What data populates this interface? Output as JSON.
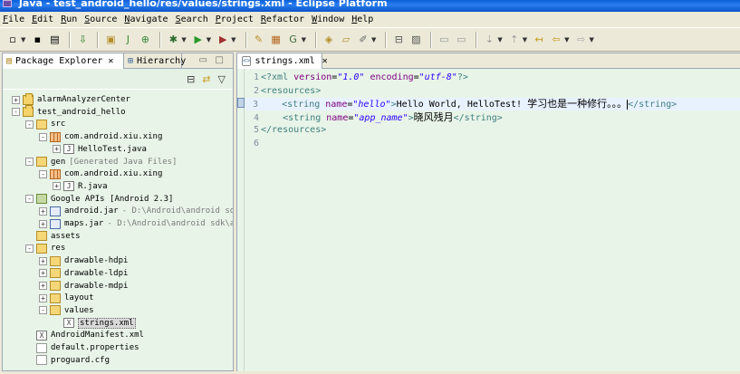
{
  "window": {
    "title": "Java - test_android_hello/res/values/strings.xml - Eclipse Platform"
  },
  "menubar": {
    "items": [
      "File",
      "Edit",
      "Run",
      "Source",
      "Navigate",
      "Search",
      "Project",
      "Refactor",
      "Window",
      "Help"
    ]
  },
  "toolbar": {
    "icons": [
      "new-wizard-icon",
      "save-icon",
      "print-icon",
      "import-icon",
      "new-java-project-icon",
      "new-package-icon",
      "new-class-icon",
      "debug-icon",
      "run-icon",
      "external-tools-icon",
      "open-type-icon",
      "open-task-icon",
      "search-icon",
      "open-perspective-icon",
      "annotation-icon",
      "back-icon",
      "forward-icon"
    ]
  },
  "left_panel": {
    "tabs": [
      {
        "label": "Package Explorer",
        "active": true
      },
      {
        "label": "Hierarchy",
        "active": false
      }
    ],
    "tree": [
      {
        "depth": 0,
        "expander": "+",
        "icon": "project",
        "label": "alarmAnalyzerCenter",
        "extra": ""
      },
      {
        "depth": 0,
        "expander": "-",
        "icon": "project",
        "label": "test_android_hello",
        "extra": ""
      },
      {
        "depth": 1,
        "expander": "-",
        "icon": "src",
        "label": "src",
        "extra": ""
      },
      {
        "depth": 2,
        "expander": "-",
        "icon": "pkg",
        "label": "com.android.xiu.xing",
        "extra": ""
      },
      {
        "depth": 3,
        "expander": "+",
        "icon": "java",
        "label": "HelloTest.java",
        "extra": ""
      },
      {
        "depth": 1,
        "expander": "-",
        "icon": "src",
        "label": "gen",
        "extra": "[Generated Java Files]"
      },
      {
        "depth": 2,
        "expander": "-",
        "icon": "pkg",
        "label": "com.android.xiu.xing",
        "extra": ""
      },
      {
        "depth": 3,
        "expander": "+",
        "icon": "java",
        "label": "R.java",
        "extra": ""
      },
      {
        "depth": 1,
        "expander": "-",
        "icon": "lib",
        "label": "Google APIs [Android 2.3]",
        "extra": ""
      },
      {
        "depth": 2,
        "expander": "+",
        "icon": "jar",
        "label": "android.jar",
        "extra": "- D:\\Android\\android sdk\\p"
      },
      {
        "depth": 2,
        "expander": "+",
        "icon": "jar",
        "label": "maps.jar",
        "extra": "- D:\\Android\\android sdk\\add-"
      },
      {
        "depth": 1,
        "expander": "",
        "icon": "folder",
        "label": "assets",
        "extra": ""
      },
      {
        "depth": 1,
        "expander": "-",
        "icon": "folder",
        "label": "res",
        "extra": ""
      },
      {
        "depth": 2,
        "expander": "+",
        "icon": "folder",
        "label": "drawable-hdpi",
        "extra": ""
      },
      {
        "depth": 2,
        "expander": "+",
        "icon": "folder",
        "label": "drawable-ldpi",
        "extra": ""
      },
      {
        "depth": 2,
        "expander": "+",
        "icon": "folder",
        "label": "drawable-mdpi",
        "extra": ""
      },
      {
        "depth": 2,
        "expander": "+",
        "icon": "folder",
        "label": "layout",
        "extra": ""
      },
      {
        "depth": 2,
        "expander": "-",
        "icon": "folder",
        "label": "values",
        "extra": ""
      },
      {
        "depth": 3,
        "expander": "",
        "icon": "xml",
        "label": "strings.xml",
        "extra": "",
        "selected": true
      },
      {
        "depth": 1,
        "expander": "",
        "icon": "xml",
        "label": "AndroidManifest.xml",
        "extra": ""
      },
      {
        "depth": 1,
        "expander": "",
        "icon": "file",
        "label": "default.properties",
        "extra": ""
      },
      {
        "depth": 1,
        "expander": "",
        "icon": "file",
        "label": "proguard.cfg",
        "extra": ""
      }
    ]
  },
  "editor": {
    "tab_label": "strings.xml",
    "lines": [
      {
        "n": "1",
        "fold": "⊖",
        "tokens": [
          {
            "t": "pi",
            "v": "<?xml "
          },
          {
            "t": "attr",
            "v": "version"
          },
          {
            "t": "eq",
            "v": "="
          },
          {
            "t": "val",
            "v": "\"1.0\""
          },
          {
            "t": "text",
            "v": " "
          },
          {
            "t": "attr",
            "v": "encoding"
          },
          {
            "t": "eq",
            "v": "="
          },
          {
            "t": "val",
            "v": "\"utf-8\""
          },
          {
            "t": "pi",
            "v": "?>"
          }
        ]
      },
      {
        "n": "2",
        "fold": "⊖",
        "tokens": [
          {
            "t": "tag",
            "v": "<resources>"
          }
        ]
      },
      {
        "n": "3",
        "fold": "",
        "current": true,
        "tokens": [
          {
            "t": "text",
            "v": "    "
          },
          {
            "t": "tag",
            "v": "<string "
          },
          {
            "t": "attr",
            "v": "name"
          },
          {
            "t": "eq",
            "v": "="
          },
          {
            "t": "val",
            "v": "\"hello\""
          },
          {
            "t": "tag",
            "v": ">"
          },
          {
            "t": "text",
            "v": "Hello World, HelloTest! "
          },
          {
            "t": "cjk",
            "v": "学习也是一种修行。。。"
          },
          {
            "t": "caret",
            "v": ""
          },
          {
            "t": "tag",
            "v": "</string>"
          }
        ]
      },
      {
        "n": "4",
        "fold": "",
        "tokens": [
          {
            "t": "text",
            "v": "    "
          },
          {
            "t": "tag",
            "v": "<string "
          },
          {
            "t": "attr",
            "v": "name"
          },
          {
            "t": "eq",
            "v": "="
          },
          {
            "t": "val",
            "v": "\"app_name\""
          },
          {
            "t": "tag",
            "v": ">"
          },
          {
            "t": "cjk",
            "v": "晓风残月"
          },
          {
            "t": "tag",
            "v": "</string>"
          }
        ]
      },
      {
        "n": "5",
        "fold": "",
        "tokens": [
          {
            "t": "tag",
            "v": "</resources>"
          }
        ]
      },
      {
        "n": "6",
        "fold": "",
        "tokens": []
      }
    ]
  }
}
